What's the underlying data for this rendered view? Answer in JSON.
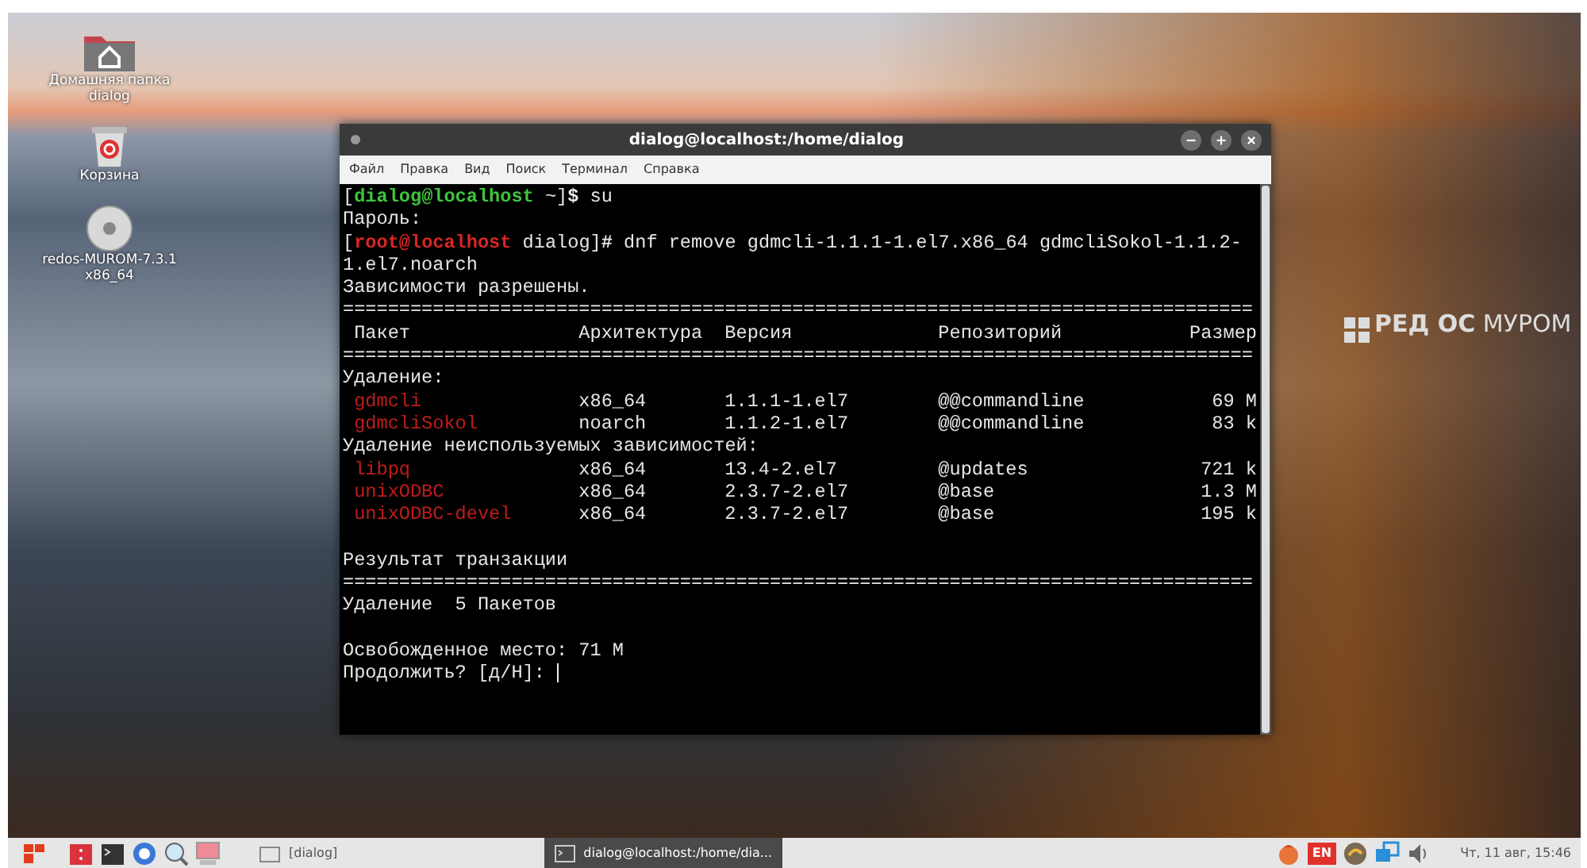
{
  "desktop": {
    "icons": [
      {
        "kind": "home-folder",
        "label": "Домашняя папка dialog"
      },
      {
        "kind": "trash",
        "label": "Корзина"
      },
      {
        "kind": "disc",
        "label": "redos-MUROM-7.3.1 x86_64"
      }
    ],
    "logo": "**РЕД ОС** МУРОМ"
  },
  "window": {
    "title": "dialog@localhost:/home/dialog",
    "menu": [
      "Файл",
      "Правка",
      "Вид",
      "Поиск",
      "Терминал",
      "Справка"
    ],
    "lines": [
      {
        "kind": "prompt",
        "segments": [
          {
            "kind": "plain",
            "text": "["
          },
          {
            "kind": "user",
            "text": "dialog@localhost"
          },
          {
            "kind": "plain",
            "text": " ~]"
          },
          {
            "kind": "bold",
            "text": "$"
          },
          {
            "kind": "plain",
            "text": " su"
          }
        ]
      },
      {
        "kind": "text",
        "text": "Пароль:"
      },
      {
        "kind": "prompt",
        "segments": [
          {
            "kind": "plain",
            "text": "["
          },
          {
            "kind": "root",
            "text": "root@localhost"
          },
          {
            "kind": "plain",
            "text": " dialog]"
          },
          {
            "kind": "bold",
            "text": "#"
          },
          {
            "kind": "plain",
            "text": " dnf remove gdmcli-1.1.1-1.el7.x86_64 gdmcliSokol-1.1.2-"
          }
        ]
      },
      {
        "kind": "text",
        "text": "1.el7.noarch"
      },
      {
        "kind": "text",
        "text": "Зависимости разрешены."
      },
      {
        "kind": "rule",
        "text": "================================================================================="
      },
      {
        "kind": "columns",
        "cells": [
          "Пакет",
          "Архитектура",
          "Версия",
          "Репозиторий",
          "Размер"
        ]
      },
      {
        "kind": "rule",
        "text": "================================================================================="
      },
      {
        "kind": "text",
        "text": "Удаление:"
      },
      {
        "kind": "package",
        "cells": [
          "gdmcli",
          "x86_64",
          "1.1.1-1.el7",
          "@@commandline",
          "69 M"
        ]
      },
      {
        "kind": "package",
        "cells": [
          "gdmcliSokol",
          "noarch",
          "1.1.2-1.el7",
          "@@commandline",
          "83 k"
        ]
      },
      {
        "kind": "text",
        "text": "Удаление неиспользуемых зависимостей:"
      },
      {
        "kind": "package",
        "cells": [
          "libpq",
          "x86_64",
          "13.4-2.el7",
          "@updates",
          "721 k"
        ]
      },
      {
        "kind": "package",
        "cells": [
          "unixODBC",
          "x86_64",
          "2.3.7-2.el7",
          "@base",
          "1.3 M"
        ]
      },
      {
        "kind": "package",
        "cells": [
          "unixODBC-devel",
          "x86_64",
          "2.3.7-2.el7",
          "@base",
          "195 k"
        ]
      },
      {
        "kind": "blank"
      },
      {
        "kind": "text",
        "text": "Результат транзакции"
      },
      {
        "kind": "rule",
        "text": "================================================================================="
      },
      {
        "kind": "text",
        "text": "Удаление  5 Пакетов"
      },
      {
        "kind": "blank"
      },
      {
        "kind": "text",
        "text": "Освобожденное место: 71 M"
      },
      {
        "kind": "input",
        "text": "Продолжить? [д/Н]: "
      }
    ]
  },
  "taskbar": {
    "launchers": [
      {
        "kind": "app"
      },
      {
        "kind": "terminal"
      },
      {
        "kind": "browser"
      },
      {
        "kind": "search"
      },
      {
        "kind": "display"
      }
    ],
    "tasks": [
      {
        "kind": "folder",
        "label": "[dialog]",
        "selected": false
      },
      {
        "kind": "terminal",
        "label": "dialog@localhost:/home/dia...",
        "selected": true
      }
    ],
    "tray": [
      {
        "kind": "ball"
      },
      {
        "kind": "layout",
        "text": "EN"
      },
      {
        "kind": "swirl"
      },
      {
        "kind": "network"
      },
      {
        "kind": "speaker"
      }
    ],
    "clock": "Чт, 11 авг, 15:46"
  }
}
